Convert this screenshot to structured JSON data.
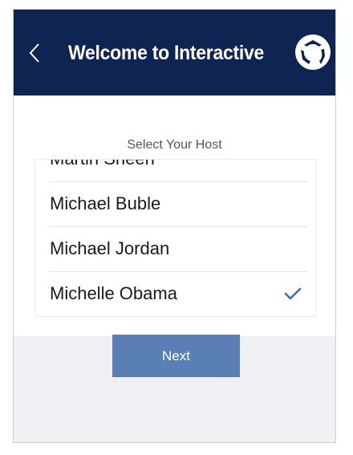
{
  "header": {
    "title": "Welcome to Interactive",
    "back_icon": "chevron-left-icon",
    "logo_icon": "circular-arrows-logo-icon",
    "background_color": "#0e2452"
  },
  "host_picker": {
    "label": "Select Your Host",
    "items": [
      {
        "name": "Martin Sheen",
        "selected": false
      },
      {
        "name": "Michael Buble",
        "selected": false
      },
      {
        "name": "Michael Jordan",
        "selected": false
      },
      {
        "name": "Michelle Obama",
        "selected": true
      }
    ],
    "check_icon": "checkmark-icon",
    "check_color": "#3d6db5"
  },
  "actions": {
    "next_label": "Next",
    "next_color": "#5a7fb5"
  }
}
